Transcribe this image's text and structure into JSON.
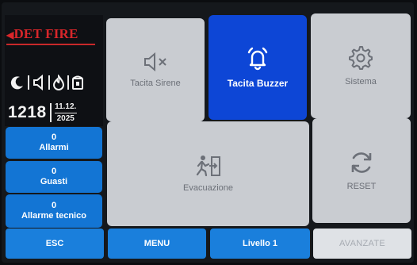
{
  "brand": {
    "logo_text": "DET FIRE"
  },
  "status_icons": [
    "moon-icon",
    "speaker-icon",
    "flame-icon",
    "phone-icon"
  ],
  "clock": {
    "time": "1218",
    "day_month": "11.12.",
    "year": "2025"
  },
  "counters": [
    {
      "value": "0",
      "label": "Allarmi"
    },
    {
      "value": "0",
      "label": "Guasti"
    },
    {
      "value": "0",
      "label": "Allarme tecnico"
    }
  ],
  "tiles": {
    "sirene": {
      "label": "Tacita Sirene",
      "icon": "speaker-mute-icon"
    },
    "buzzer": {
      "label": "Tacita Buzzer",
      "icon": "bell-icon"
    },
    "sistema": {
      "label": "Sistema",
      "icon": "gear-icon"
    },
    "evacuazione": {
      "label": "Evacuazione",
      "icon": "exit-run-icon"
    },
    "reset": {
      "label": "RESET",
      "icon": "refresh-icon"
    }
  },
  "bottom": {
    "esc": "ESC",
    "menu": "MENU",
    "livello": "Livello 1",
    "avanzate": "AVANZATE"
  },
  "colors": {
    "primary_blue": "#1a7fdc",
    "active_tile": "#0d46d6",
    "tile_grey": "#c9ccd1",
    "logo_red": "#d8262a"
  }
}
